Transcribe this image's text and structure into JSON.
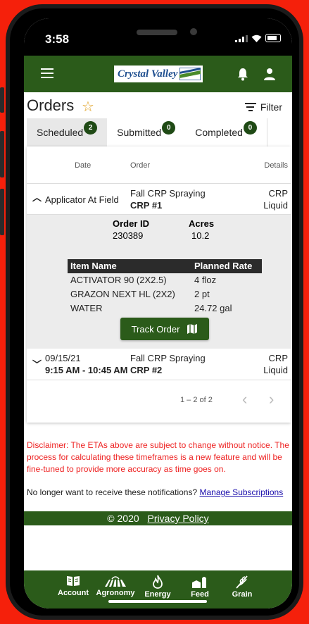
{
  "status": {
    "time": "3:58"
  },
  "app": {
    "brand": "Crystal Valley"
  },
  "page": {
    "title": "Orders",
    "filter_label": "Filter"
  },
  "tabs": [
    {
      "label": "Scheduled",
      "count": "2",
      "active": true
    },
    {
      "label": "Submitted",
      "count": "0",
      "active": false
    },
    {
      "label": "Completed",
      "count": "0",
      "active": false
    }
  ],
  "table": {
    "headers": {
      "date": "Date",
      "order": "Order",
      "details": "Details"
    },
    "rows": [
      {
        "status": "Applicator At Field",
        "order_title": "Fall CRP Spraying",
        "order_code": "CRP #1",
        "details_line1": "CRP",
        "details_line2": "Liquid"
      },
      {
        "date": "09/15/21",
        "time": "9:15 AM - 10:45 AM",
        "order_title": "Fall CRP Spraying",
        "order_code": "CRP #2",
        "details_line1": "CRP",
        "details_line2": "Liquid"
      }
    ],
    "detail": {
      "order_id_label": "Order ID",
      "order_id": "230389",
      "acres_label": "Acres",
      "acres": "10.2",
      "items_headers": {
        "name": "Item Name",
        "rate": "Planned Rate"
      },
      "items": [
        {
          "name": "ACTIVATOR 90 (2X2.5)",
          "rate": "4 floz"
        },
        {
          "name": "GRAZON NEXT HL (2X2)",
          "rate": "2 pt"
        },
        {
          "name": "WATER",
          "rate": "24.72 gal"
        }
      ],
      "track_label": "Track Order"
    },
    "pagination": {
      "range": "1 – 2 of 2",
      "prev": "‹",
      "next": "›"
    }
  },
  "disclaimer": "Disclaimer: The ETAs above are subject to change without notice. The process for calculating these timeframes is a new feature and will be fine-tuned to provide more accuracy as time goes on.",
  "notifications": {
    "text": "No longer want to receive these notifications?",
    "link": "Manage Subscriptions"
  },
  "footer": {
    "copyright": "© 2020",
    "privacy": "Privacy Policy"
  },
  "bottom_nav": [
    {
      "label": "Account",
      "icon": "book-icon"
    },
    {
      "label": "Agronomy",
      "icon": "field-icon"
    },
    {
      "label": "Energy",
      "icon": "flame-icon"
    },
    {
      "label": "Feed",
      "icon": "barn-icon"
    },
    {
      "label": "Grain",
      "icon": "wheat-icon"
    }
  ],
  "colors": {
    "brand_green": "#2b5b1a",
    "badge_green": "#1f4a15",
    "disclaimer_red": "#ee2222",
    "frame_red": "#f5200b"
  }
}
